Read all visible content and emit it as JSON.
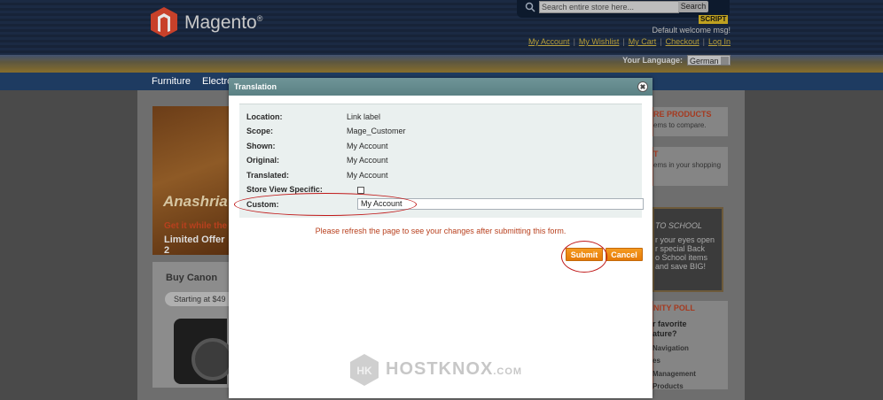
{
  "store": {
    "logo_text": "Magento",
    "logo_mark": "®",
    "search_placeholder": "Search entire store here...",
    "search_button": "Search",
    "script_badge": "SCRIPT",
    "welcome": "Default welcome msg!",
    "links": [
      "My Account",
      "My Wishlist",
      "My Cart",
      "Checkout",
      "Log In"
    ],
    "language_label": "Your Language:",
    "language_value": "German",
    "nav": [
      "Furniture",
      "Electro"
    ],
    "banner1": {
      "big": "Anashria",
      "get": "Get it while the",
      "limited": "Limited Offer 2"
    },
    "banner2": {
      "buy": "Buy Canon",
      "starting": "Starting at $49"
    },
    "side": {
      "compare_title": "RE PRODUCTS",
      "compare_text": "ems to compare.",
      "cart_title": "T",
      "cart_text": "ems in your shopping",
      "school_lines": [
        "TO SCHOOL",
        "r your eyes open",
        "r special Back",
        "o School items",
        "and save BIG!"
      ],
      "poll_title": "NITY POLL",
      "poll_question_1": "r favorite",
      "poll_question_2": "ature?",
      "poll_options": [
        "Navigation",
        "es",
        "Management",
        "Products"
      ]
    },
    "watermark": "HOSTKNOX",
    "watermark_suffix": ".COM"
  },
  "dialog": {
    "title": "Translation",
    "rows": [
      {
        "label": "Location:",
        "value": "Link label"
      },
      {
        "label": "Scope:",
        "value": "Mage_Customer"
      },
      {
        "label": "Shown:",
        "value": "My Account"
      },
      {
        "label": "Original:",
        "value": "My Account"
      },
      {
        "label": "Translated:",
        "value": "My Account"
      },
      {
        "label": "Store View Specific:",
        "value": ""
      },
      {
        "label": "Custom:",
        "value": ""
      }
    ],
    "store_view_specific_checked": false,
    "custom_value": "My Account",
    "notice": "Please refresh the page to see your changes after submitting this form.",
    "submit_label": "Submit",
    "cancel_label": "Cancel"
  },
  "colors": {
    "accent_orange": "#e57a07",
    "notice_red": "#b8401e",
    "annotation_red": "#c01818",
    "titlebar": "#5b8184"
  }
}
